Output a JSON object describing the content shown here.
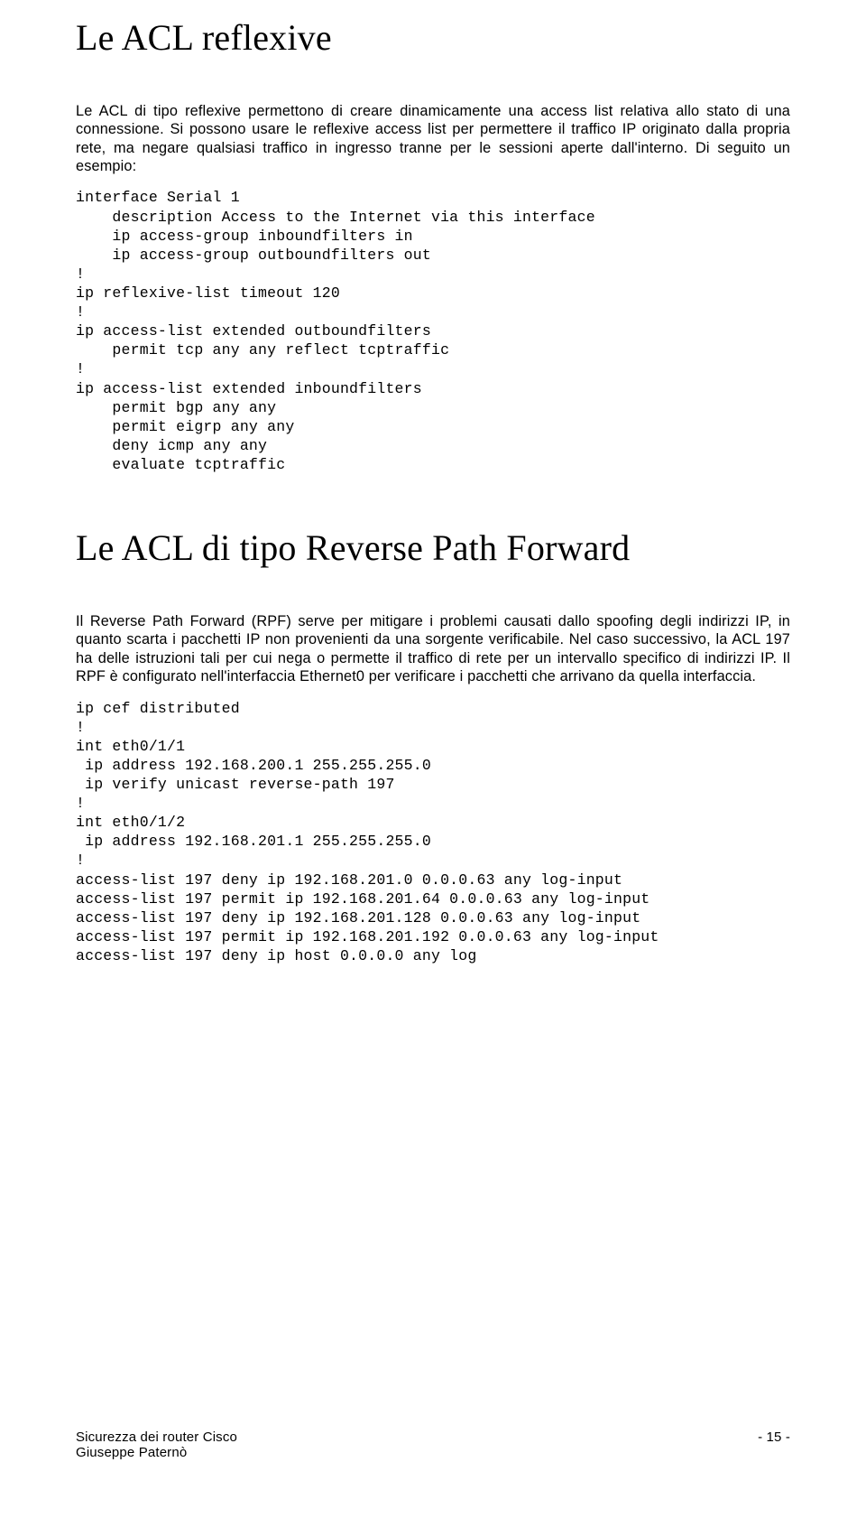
{
  "section1": {
    "title": "Le ACL reflexive",
    "para": "Le ACL di tipo reflexive permettono di creare dinamicamente una access list relativa allo stato di una connessione. Si possono usare le reflexive access list per permettere il traffico IP originato dalla propria rete, ma negare qualsiasi traffico in ingresso tranne per le sessioni aperte dall'interno. Di seguito un esempio:",
    "code": "interface Serial 1\n    description Access to the Internet via this interface\n    ip access-group inboundfilters in\n    ip access-group outboundfilters out\n!\nip reflexive-list timeout 120\n!\nip access-list extended outboundfilters\n    permit tcp any any reflect tcptraffic\n!\nip access-list extended inboundfilters\n    permit bgp any any\n    permit eigrp any any\n    deny icmp any any\n    evaluate tcptraffic"
  },
  "section2": {
    "title": "Le ACL di tipo Reverse Path Forward",
    "para": "Il Reverse Path Forward (RPF) serve per mitigare i problemi causati dallo spoofing degli indirizzi IP, in quanto scarta i pacchetti IP non provenienti da una sorgente verificabile. Nel caso successivo, la ACL 197 ha delle istruzioni tali per cui nega o permette il traffico di rete per un intervallo specifico di indirizzi IP. Il RPF è configurato nell'interfaccia Ethernet0 per verificare i pacchetti che arrivano da quella interfaccia.",
    "code": "ip cef distributed\n!\nint eth0/1/1\n ip address 192.168.200.1 255.255.255.0\n ip verify unicast reverse-path 197\n!\nint eth0/1/2\n ip address 192.168.201.1 255.255.255.0\n!\naccess-list 197 deny ip 192.168.201.0 0.0.0.63 any log-input\naccess-list 197 permit ip 192.168.201.64 0.0.0.63 any log-input\naccess-list 197 deny ip 192.168.201.128 0.0.0.63 any log-input\naccess-list 197 permit ip 192.168.201.192 0.0.0.63 any log-input\naccess-list 197 deny ip host 0.0.0.0 any log"
  },
  "footer": {
    "left1": "Sicurezza dei router Cisco",
    "left2": "Giuseppe Paternò",
    "right": "- 15 -"
  }
}
